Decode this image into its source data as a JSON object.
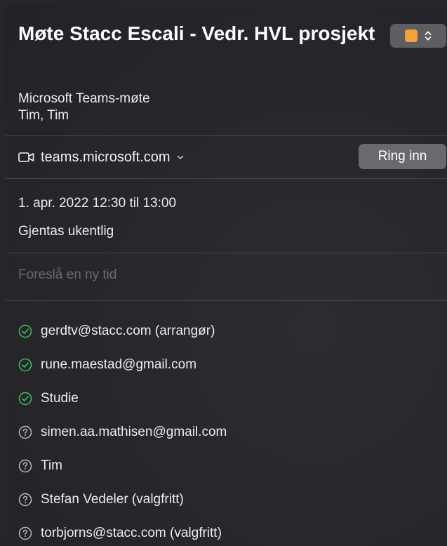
{
  "event": {
    "title": "Møte Stacc Escali - Vedr. HVL prosjekt",
    "color": "#f5a13a",
    "subtitle": "Microsoft Teams-møte",
    "organizer_line": "Tim, Tim"
  },
  "meeting": {
    "link_text": "teams.microsoft.com",
    "call_button": "Ring inn"
  },
  "schedule": {
    "datetime": "1. apr. 2022 12:30 til 13:00",
    "recurrence": "Gjentas ukentlig",
    "propose_placeholder": "Foreslå en ny tid"
  },
  "attendees": [
    {
      "status": "accepted",
      "icon": "check-circle-icon",
      "label": "gerdtv@stacc.com (arrangør)"
    },
    {
      "status": "accepted",
      "icon": "check-circle-icon",
      "label": "rune.maestad@gmail.com"
    },
    {
      "status": "accepted",
      "icon": "check-circle-icon",
      "label": "Studie"
    },
    {
      "status": "unknown",
      "icon": "question-circle-icon",
      "label": "simen.aa.mathisen@gmail.com"
    },
    {
      "status": "unknown",
      "icon": "question-circle-icon",
      "label": "Tim"
    },
    {
      "status": "unknown",
      "icon": "question-circle-icon",
      "label": "Stefan Vedeler (valgfritt)"
    },
    {
      "status": "unknown",
      "icon": "question-circle-icon",
      "label": "torbjorns@stacc.com (valgfritt)"
    }
  ],
  "colors": {
    "accepted": "#33c759",
    "unknown": "#b8b8bc"
  }
}
